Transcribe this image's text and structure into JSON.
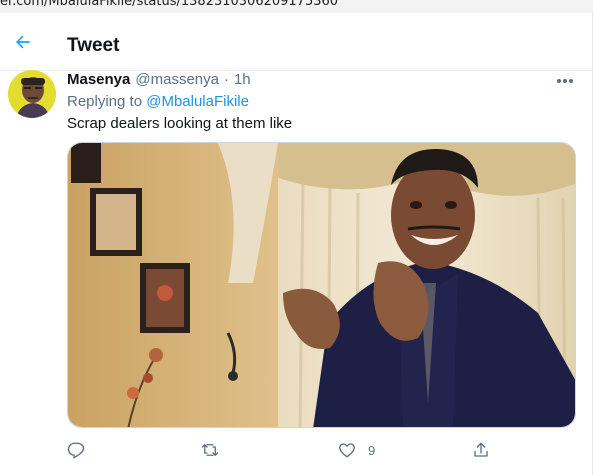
{
  "browser": {
    "url_fragment": "er.com/MbalulaFikile/status/1382310306209175360"
  },
  "header": {
    "title": "Tweet"
  },
  "tweet": {
    "author_name": "Masenya",
    "author_handle": "@massenya",
    "separator": "·",
    "time": "1h",
    "replying_prefix": "Replying to",
    "replying_to": "@MbalulaFikile",
    "text": "Scrap dealers looking at them like",
    "likes": "9"
  },
  "icons": {
    "back": "back-arrow-icon",
    "more": "more-dots-icon",
    "reply": "reply-icon",
    "retweet": "retweet-icon",
    "like": "heart-icon",
    "share": "share-icon"
  },
  "colors": {
    "accent": "#1da1f2",
    "muted": "#5b7083",
    "link": "#1b95e0",
    "text": "#0f1419"
  }
}
